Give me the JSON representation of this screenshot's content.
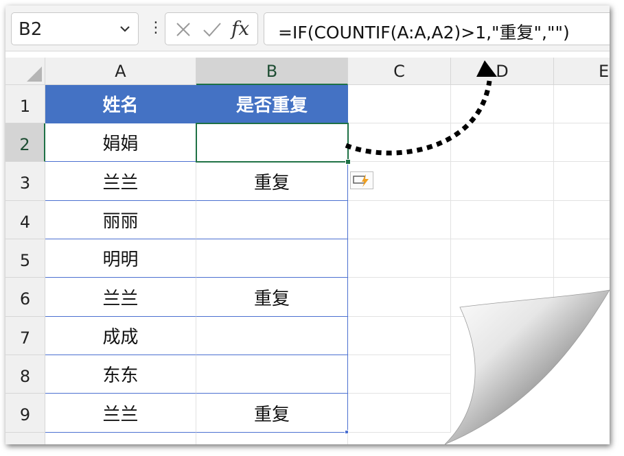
{
  "name_box": {
    "value": "B2"
  },
  "formula_bar": {
    "more_dots": "⋮",
    "fx_label": "fx",
    "formula": "=IF(COUNTIF(A:A,A2)>1,\"重复\",\"\")"
  },
  "columns": [
    "A",
    "B",
    "C",
    "D",
    "E"
  ],
  "selected_column": "B",
  "rows": [
    "1",
    "2",
    "3",
    "4",
    "5",
    "6",
    "7",
    "8",
    "9"
  ],
  "selected_row": "2",
  "table": {
    "headers": [
      "姓名",
      "是否重复"
    ],
    "cells": [
      [
        "娟娟",
        ""
      ],
      [
        "兰兰",
        "重复"
      ],
      [
        "丽丽",
        ""
      ],
      [
        "明明",
        ""
      ],
      [
        "兰兰",
        "重复"
      ],
      [
        "成成",
        ""
      ],
      [
        "东东",
        ""
      ],
      [
        "兰兰",
        "重复"
      ]
    ]
  },
  "colors": {
    "header_fill": "#4472c4",
    "selection": "#1e7145",
    "table_border": "#4a6fd0",
    "flash_icon": "#f0a020"
  },
  "icons": [
    "chevron-down-icon",
    "cancel-x-icon",
    "confirm-check-icon",
    "fx-icon",
    "flash-fill-icon",
    "dotted-arrow",
    "page-curl"
  ]
}
